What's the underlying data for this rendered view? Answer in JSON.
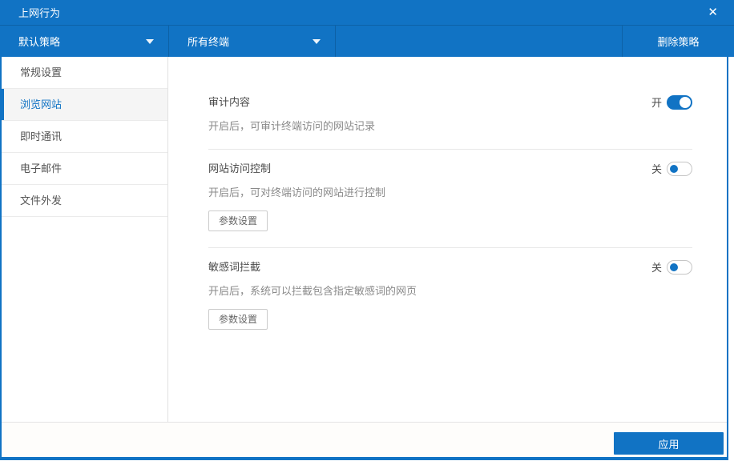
{
  "window": {
    "title": "上网行为",
    "close_glyph": "✕"
  },
  "toolbar": {
    "policy_dropdown": {
      "value": "默认策略"
    },
    "terminal_dropdown": {
      "value": "所有终端"
    },
    "delete_button_label": "删除策略"
  },
  "sidebar": {
    "items": [
      {
        "label": "常规设置",
        "active": false
      },
      {
        "label": "浏览网站",
        "active": true
      },
      {
        "label": "即时通讯",
        "active": false
      },
      {
        "label": "电子邮件",
        "active": false
      },
      {
        "label": "文件外发",
        "active": false
      }
    ]
  },
  "settings": {
    "audit": {
      "name": "审计内容",
      "description": "开启后，可审计终端访问的网站记录",
      "state_label": "开",
      "enabled": true
    },
    "access_control": {
      "name": "网站访问控制",
      "description": "开启后，可对终端访问的网站进行控制",
      "state_label": "关",
      "enabled": false,
      "params_button_label": "参数设置"
    },
    "sensitive_words": {
      "name": "敏感词拦截",
      "description": "开启后，系统可以拦截包含指定敏感词的网页",
      "state_label": "关",
      "enabled": false,
      "params_button_label": "参数设置"
    }
  },
  "footer": {
    "apply_label": "应用"
  },
  "colors": {
    "primary_blue": "#1173c4",
    "toolbar_divider": "#0d61a6",
    "active_sidebar_text": "#1173c4",
    "toggle_on": "#1173c4",
    "divider_gray": "#e8e8e8"
  }
}
